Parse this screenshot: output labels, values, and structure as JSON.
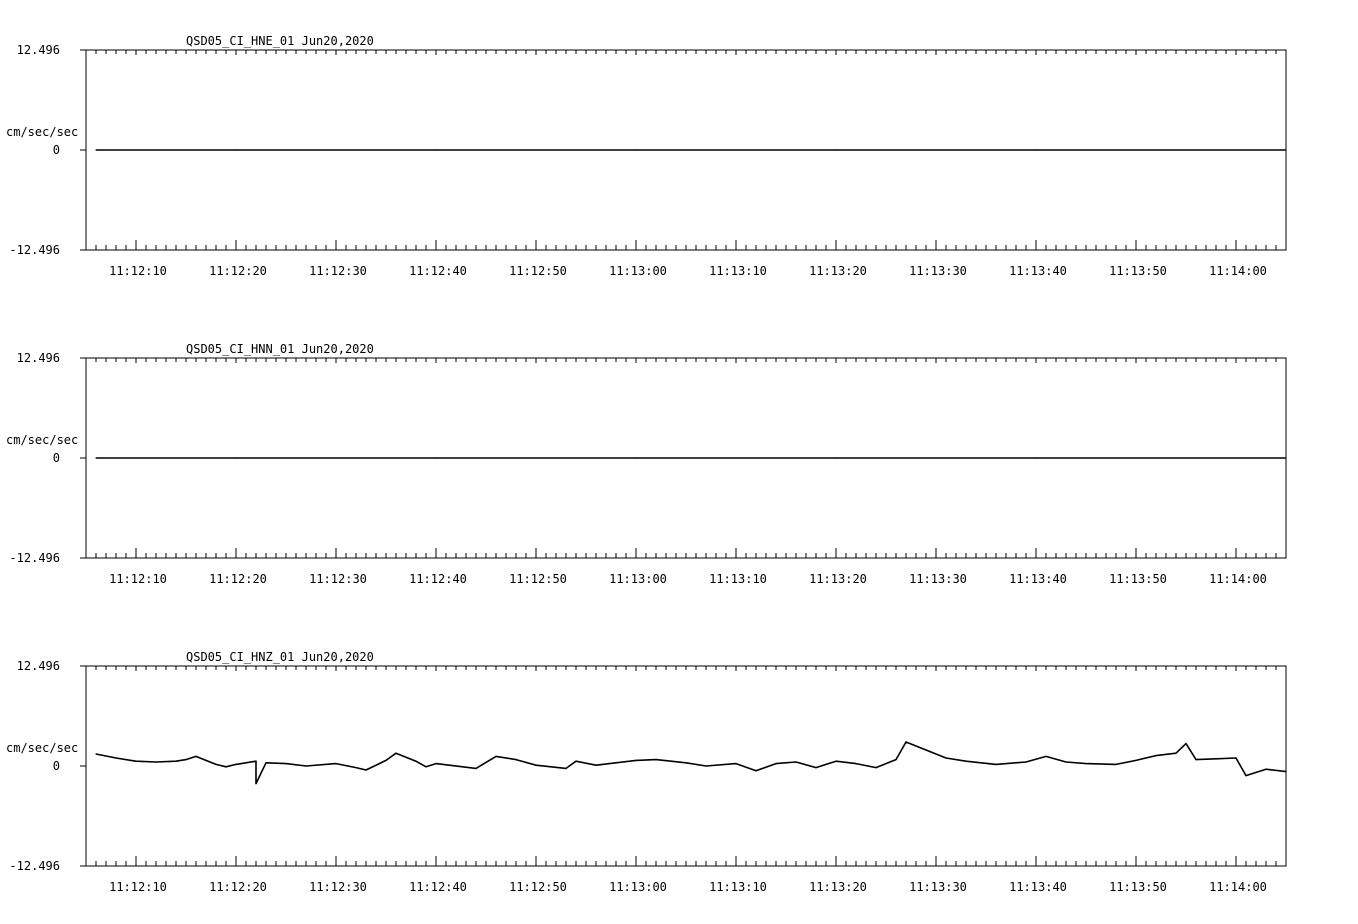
{
  "chart_data": [
    {
      "type": "line",
      "title": "QSD05_CI_HNE_01  Jun20,2020",
      "ylabel": "cm/sec/sec",
      "ylim": [
        -12.496,
        12.496
      ],
      "yticks": [
        "12.496",
        "0",
        "-12.496"
      ],
      "x_tick_labels": [
        "11:12:10",
        "11:12:20",
        "11:12:30",
        "11:12:40",
        "11:12:50",
        "11:13:00",
        "11:13:10",
        "11:13:20",
        "11:13:30",
        "11:13:40",
        "11:13:50",
        "11:14:00"
      ],
      "xlim": [
        "11:12:05",
        "11:14:05"
      ],
      "series": [
        {
          "x": [
            "11:12:06",
            "11:12:20",
            "11:12:40",
            "11:13:00",
            "11:13:20",
            "11:13:40",
            "11:14:05"
          ],
          "values": [
            0,
            0,
            0,
            0,
            0,
            0,
            0
          ]
        }
      ]
    },
    {
      "type": "line",
      "title": "QSD05_CI_HNN_01  Jun20,2020",
      "ylabel": "cm/sec/sec",
      "ylim": [
        -12.496,
        12.496
      ],
      "yticks": [
        "12.496",
        "0",
        "-12.496"
      ],
      "x_tick_labels": [
        "11:12:10",
        "11:12:20",
        "11:12:30",
        "11:12:40",
        "11:12:50",
        "11:13:00",
        "11:13:10",
        "11:13:20",
        "11:13:30",
        "11:13:40",
        "11:13:50",
        "11:14:00"
      ],
      "xlim": [
        "11:12:05",
        "11:14:05"
      ],
      "series": [
        {
          "x": [
            "11:12:06",
            "11:12:20",
            "11:12:40",
            "11:13:00",
            "11:13:20",
            "11:13:40",
            "11:14:05"
          ],
          "values": [
            0,
            0,
            0,
            0,
            0,
            0,
            0
          ]
        }
      ]
    },
    {
      "type": "line",
      "title": "QSD05_CI_HNZ_01  Jun20,2020",
      "ylabel": "cm/sec/sec",
      "ylim": [
        -12.496,
        12.496
      ],
      "yticks": [
        "12.496",
        "0",
        "-12.496"
      ],
      "x_tick_labels": [
        "11:12:10",
        "11:12:20",
        "11:12:30",
        "11:12:40",
        "11:12:50",
        "11:13:00",
        "11:13:10",
        "11:13:20",
        "11:13:30",
        "11:13:40",
        "11:13:50",
        "11:14:00"
      ],
      "xlim": [
        "11:12:05",
        "11:14:05"
      ],
      "series": [
        {
          "x": [
            "11:12:06",
            "11:12:08",
            "11:12:10",
            "11:12:12",
            "11:12:14",
            "11:12:15",
            "11:12:16",
            "11:12:18",
            "11:12:19",
            "11:12:20",
            "11:12:22",
            "11:12:22",
            "11:12:23",
            "11:12:25",
            "11:12:27",
            "11:12:30",
            "11:12:32",
            "11:12:33",
            "11:12:35",
            "11:12:36",
            "11:12:38",
            "11:12:39",
            "11:12:40",
            "11:12:44",
            "11:12:46",
            "11:12:48",
            "11:12:50",
            "11:12:53",
            "11:12:54",
            "11:12:56",
            "11:12:58",
            "11:13:00",
            "11:13:02",
            "11:13:05",
            "11:13:07",
            "11:13:10",
            "11:13:12",
            "11:13:14",
            "11:13:16",
            "11:13:18",
            "11:13:20",
            "11:13:22",
            "11:13:24",
            "11:13:26",
            "11:13:27",
            "11:13:29",
            "11:13:31",
            "11:13:33",
            "11:13:36",
            "11:13:39",
            "11:13:41",
            "11:13:43",
            "11:13:45",
            "11:13:48",
            "11:13:50",
            "11:13:52",
            "11:13:54",
            "11:13:55",
            "11:13:56",
            "11:13:58",
            "11:14:00",
            "11:14:01",
            "11:14:03",
            "11:14:05"
          ],
          "values": [
            1.5,
            1.0,
            0.6,
            0.5,
            0.6,
            0.8,
            1.2,
            0.2,
            -0.1,
            0.2,
            0.6,
            -2.2,
            0.4,
            0.3,
            0.0,
            0.3,
            -0.2,
            -0.5,
            0.7,
            1.6,
            0.6,
            -0.1,
            0.3,
            -0.3,
            1.2,
            0.8,
            0.1,
            -0.3,
            0.6,
            0.1,
            0.4,
            0.7,
            0.8,
            0.4,
            0.0,
            0.3,
            -0.6,
            0.3,
            0.5,
            -0.2,
            0.6,
            0.3,
            -0.2,
            0.8,
            3.0,
            2.0,
            1.0,
            0.6,
            0.2,
            0.5,
            1.2,
            0.5,
            0.3,
            0.2,
            0.7,
            1.3,
            1.6,
            2.8,
            0.8,
            0.9,
            1.0,
            -1.2,
            -0.4,
            -0.7
          ]
        }
      ]
    }
  ]
}
